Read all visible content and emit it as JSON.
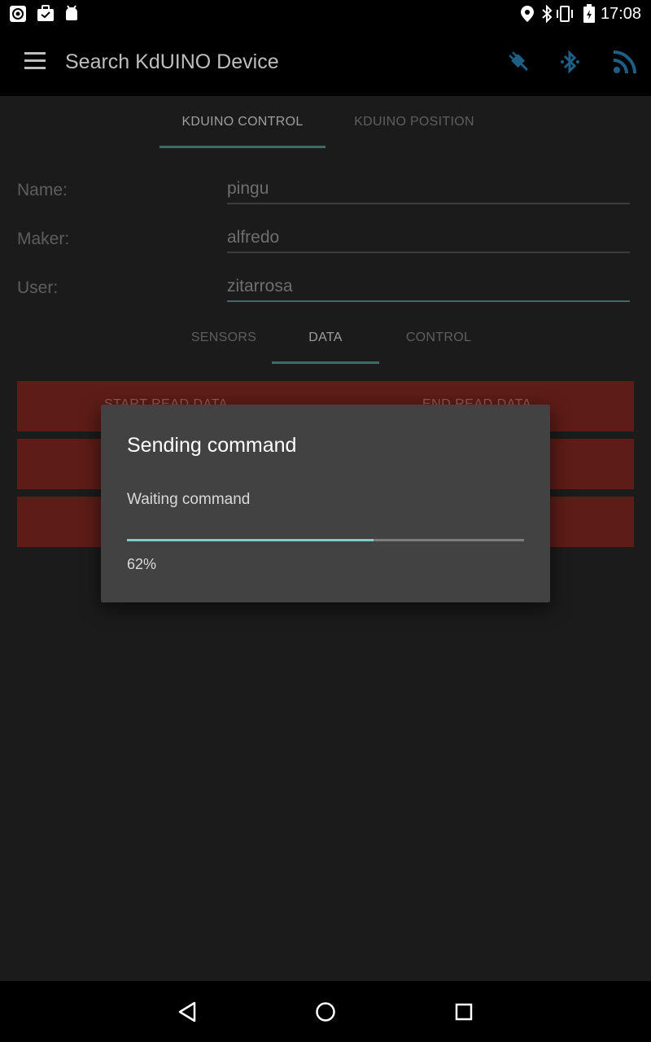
{
  "status_bar": {
    "time": "17:08",
    "icons": [
      "sync-icon",
      "briefcase-icon",
      "android-debug-icon",
      "location-icon",
      "bluetooth-icon",
      "vibrate-icon",
      "battery-icon"
    ]
  },
  "app_bar": {
    "title": "Search KdUINO Device",
    "actions": [
      "plug-connect-icon",
      "bluetooth-searching-icon",
      "rss-feed-icon"
    ]
  },
  "main_tabs": [
    {
      "label": "KDUINO CONTROL",
      "selected": true
    },
    {
      "label": "KDUINO POSITION",
      "selected": false
    }
  ],
  "form": {
    "fields": [
      {
        "label": "Name:",
        "value": "pingu"
      },
      {
        "label": "Maker:",
        "value": "alfredo"
      },
      {
        "label": "User:",
        "value": "zitarrosa"
      }
    ]
  },
  "sub_tabs": [
    {
      "label": "SENSORS",
      "selected": false
    },
    {
      "label": "DATA",
      "selected": true
    },
    {
      "label": "CONTROL",
      "selected": false
    }
  ],
  "buttons": {
    "row1": {
      "left_label": "START READ DATA",
      "right_label": "END READ DATA"
    }
  },
  "dialog": {
    "title": "Sending command",
    "message": "Waiting command",
    "progress_percent_text": "62%",
    "progress_fraction": 0.62
  },
  "nav_bar": [
    "back-icon",
    "home-icon",
    "recents-icon"
  ],
  "colors": {
    "accent": "#80cbc4",
    "button_red": "#5d1c17",
    "dialog_bg": "#424242",
    "background": "#1b1b1b"
  }
}
